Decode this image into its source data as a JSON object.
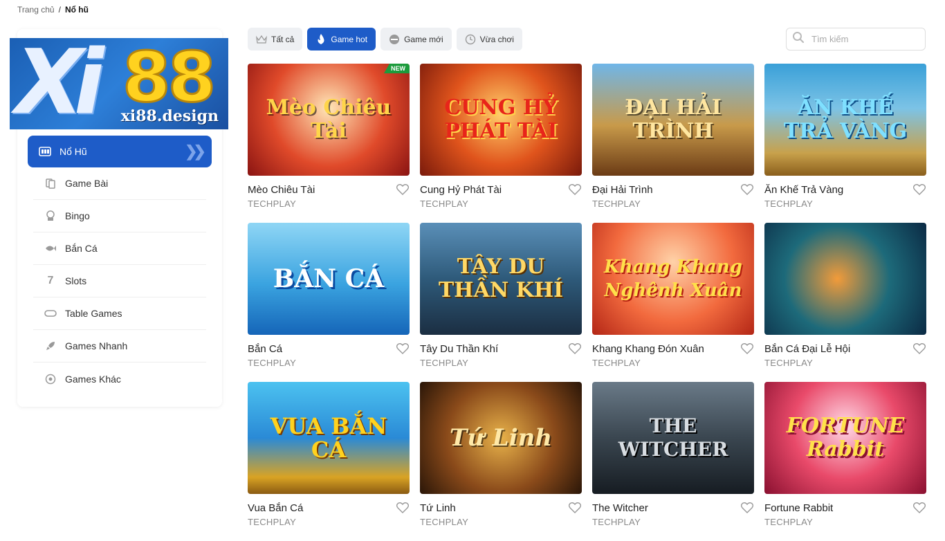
{
  "breadcrumb": {
    "home": "Trang chủ",
    "separator": "/",
    "current": "Nổ hũ"
  },
  "logo": {
    "mark": "Xi",
    "number": "88",
    "domain": "xi88.design"
  },
  "sidebar": {
    "items": [
      {
        "label": "Nổ Hũ",
        "icon": "slot-machine-icon",
        "active": true
      },
      {
        "label": "Game Bài",
        "icon": "cards-icon"
      },
      {
        "label": "Bingo",
        "icon": "bingo-icon"
      },
      {
        "label": "Bắn Cá",
        "icon": "fish-icon"
      },
      {
        "label": "Slots",
        "icon": "seven-icon"
      },
      {
        "label": "Table Games",
        "icon": "table-icon"
      },
      {
        "label": "Games Nhanh",
        "icon": "rocket-icon"
      },
      {
        "label": "Games Khác",
        "icon": "circle-dot-icon"
      }
    ]
  },
  "tabs": [
    {
      "label": "Tất cả",
      "icon": "crown-icon"
    },
    {
      "label": "Game hot",
      "icon": "flame-icon",
      "active": true
    },
    {
      "label": "Game mới",
      "icon": "new-icon"
    },
    {
      "label": "Vừa chơi",
      "icon": "clock-icon"
    }
  ],
  "search": {
    "placeholder": "Tìm kiếm"
  },
  "games": [
    {
      "name": "Mèo Chiêu Tài",
      "provider": "TECHPLAY",
      "art": "Mèo Chiêu Tài",
      "badge": "NEW"
    },
    {
      "name": "Cung Hỷ Phát Tài",
      "provider": "TECHPLAY",
      "art": "CUNG HỶ PHÁT TÀI"
    },
    {
      "name": "Đại Hải Trình",
      "provider": "TECHPLAY",
      "art": "ĐẠI HẢI TRÌNH"
    },
    {
      "name": "Ăn Khế Trả Vàng",
      "provider": "TECHPLAY",
      "art": "ĂN KHẾ TRẢ VÀNG"
    },
    {
      "name": "Bắn Cá",
      "provider": "TECHPLAY",
      "art": "BẮN CÁ"
    },
    {
      "name": "Tây Du Thần Khí",
      "provider": "TECHPLAY",
      "art": "TÂY DU THẦN KHÍ"
    },
    {
      "name": "Khang Khang Đón Xuân",
      "provider": "TECHPLAY",
      "art": "Khang Khang Nghênh Xuân"
    },
    {
      "name": "Bắn Cá Đại Lễ Hội",
      "provider": "TECHPLAY",
      "art": ""
    },
    {
      "name": "Vua Bắn Cá",
      "provider": "TECHPLAY",
      "art": "VUA BẮN CÁ"
    },
    {
      "name": "Tứ Linh",
      "provider": "TECHPLAY",
      "art": "Tứ Linh"
    },
    {
      "name": "The Witcher",
      "provider": "TECHPLAY",
      "art": "THE WITCHER"
    },
    {
      "name": "Fortune Rabbit",
      "provider": "TECHPLAY",
      "art": "FORTUNE Rabbit"
    }
  ]
}
